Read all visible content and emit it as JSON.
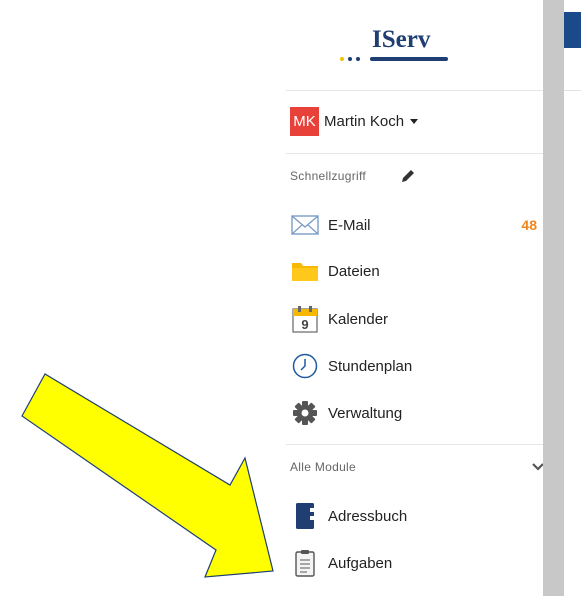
{
  "brand": {
    "name": "IServ",
    "color": "#1f3e72",
    "dot_colors": [
      "#f3c200",
      "#1f3e72",
      "#1f3e72"
    ]
  },
  "user": {
    "initials": "MK",
    "name": "Martin Koch",
    "avatar_color": "#e8413a"
  },
  "quick_access": {
    "label": "Schnellzugriff",
    "items": [
      {
        "label": "E-Mail",
        "icon": "envelope-icon",
        "badge": "48"
      },
      {
        "label": "Dateien",
        "icon": "folder-icon"
      },
      {
        "label": "Kalender",
        "icon": "calendar-icon",
        "day": "9"
      },
      {
        "label": "Stundenplan",
        "icon": "clock-icon"
      },
      {
        "label": "Verwaltung",
        "icon": "gear-icon"
      }
    ]
  },
  "all_modules": {
    "label": "Alle Module",
    "items": [
      {
        "label": "Adressbuch",
        "icon": "address-book-icon"
      },
      {
        "label": "Aufgaben",
        "icon": "clipboard-icon"
      }
    ]
  },
  "colors": {
    "badge": "#f0861e",
    "arrow_fill": "#ffff00",
    "arrow_stroke": "#1f3e72"
  }
}
